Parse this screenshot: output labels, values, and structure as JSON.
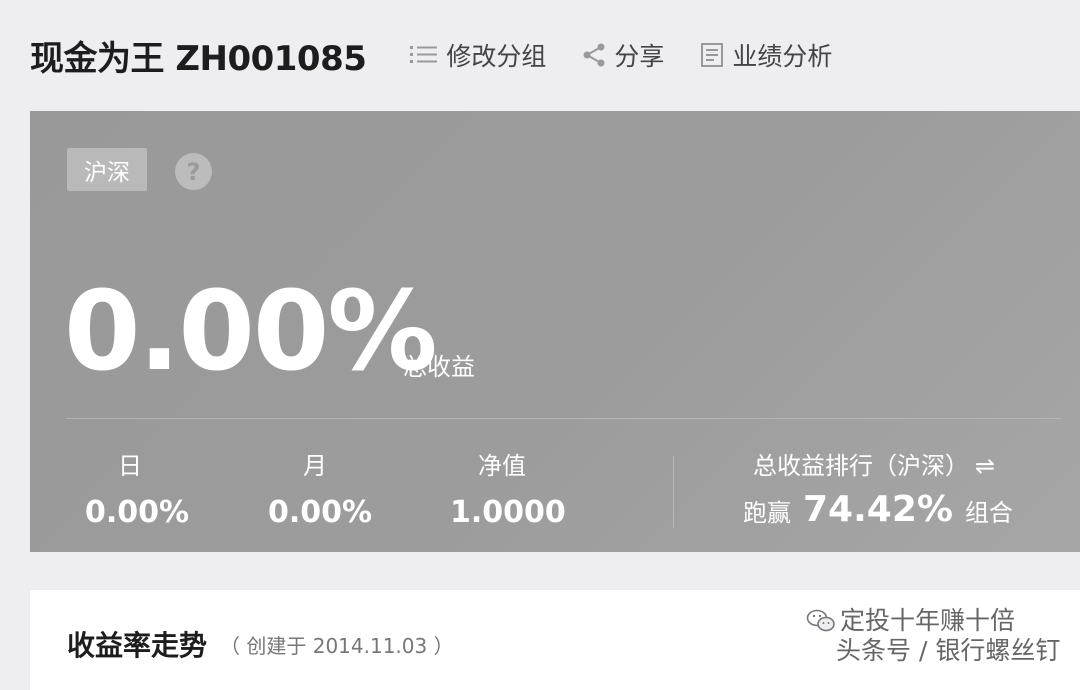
{
  "header": {
    "title": "现金为王 ZH001085",
    "actions": {
      "edit_group": "修改分组",
      "share": "分享",
      "performance": "业绩分析"
    }
  },
  "summary": {
    "market_badge": "沪深",
    "help_glyph": "?",
    "total_return": "0.00%",
    "total_return_label": "总收益",
    "stats": {
      "day": {
        "label": "日",
        "value": "0.00%"
      },
      "month": {
        "label": "月",
        "value": "0.00%"
      },
      "nav": {
        "label": "净值",
        "value": "1.0000"
      }
    },
    "ranking": {
      "label": "总收益排行（沪深）",
      "switch_glyph": "⇌",
      "prefix": "跑赢",
      "percent": "74.42%",
      "suffix": "组合"
    }
  },
  "trend": {
    "title": "收益率走势",
    "created": "（ 创建于 2014.11.03 ）"
  },
  "watermark": {
    "line1": "定投十年赚十倍",
    "line2": "头条号 / 银行螺丝钉"
  }
}
